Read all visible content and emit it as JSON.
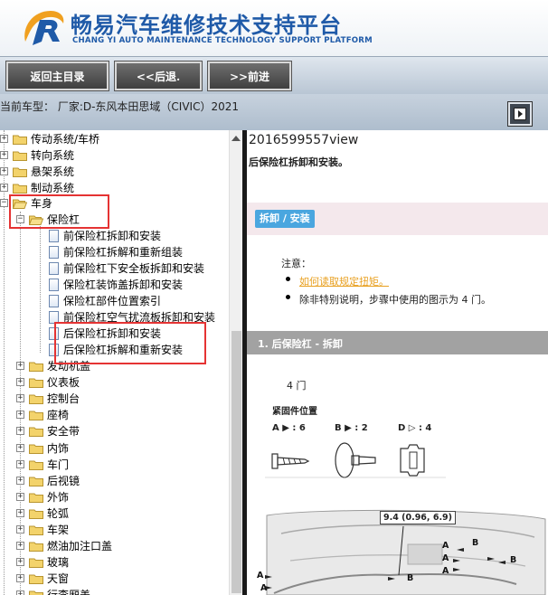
{
  "header": {
    "title_cn": "畅易汽车维修技术支持平台",
    "title_en": "CHANG YI AUTO MAINTENANCE TECHNOLOGY SUPPORT PLATFORM"
  },
  "toolbar": {
    "home_label": "返回主目录",
    "back_label": "<<后退.",
    "forward_label": ">>前进"
  },
  "vehicle": {
    "text": "当前车型： 厂家:D-东风本田思域（CIVIC）2021"
  },
  "tree": {
    "top_items": [
      "传动系统/车桥",
      "转向系统",
      "悬架系统",
      "制动系统"
    ],
    "body_label": "车身",
    "bumper_label": "保险杠",
    "bumper_docs": [
      "前保险杠拆卸和安装",
      "前保险杠拆解和重新组装",
      "前保险杠下安全板拆卸和安装",
      "保险杠装饰盖拆卸和安装",
      "保险杠部件位置索引",
      "前保险杠空气扰流板拆卸和安装",
      "后保险杠拆卸和安装",
      "后保险杠拆解和重新安装"
    ],
    "sub_folders": [
      "发动机盖",
      "仪表板",
      "控制台",
      "座椅",
      "安全带",
      "内饰",
      "车门",
      "后视镜",
      "外饰",
      "轮弧",
      "车架",
      "燃油加注口盖",
      "玻璃",
      "天窗",
      "行李厢盖"
    ]
  },
  "content": {
    "view_id": "2016599557view",
    "title": "后保险杠拆卸和安装。",
    "section_button": "拆卸 / 安装",
    "note_label": "注意：",
    "note_link": "如何读取规定扭矩。",
    "note_text": "除非特别说明，步骤中使用的图示为 4 门。",
    "step_title": "1. 后保险杠 - 拆卸",
    "door_label": "4 门",
    "fastener_label": "紧固件位置",
    "fastener_codes": [
      "A ▶ : 6",
      "B ▶ : 2",
      "D ▷ : 4"
    ],
    "torque": "9.4 (0.96, 6.9)",
    "callouts": [
      "A",
      "A",
      "A",
      "A",
      "A",
      "B",
      "B",
      "B"
    ]
  },
  "colors": {
    "brand_blue": "#1f5aa8",
    "highlight_red": "#e53333",
    "section_blue": "#4aa6df",
    "step_gray": "#a2a2a2",
    "link_orange": "#e8a020"
  }
}
